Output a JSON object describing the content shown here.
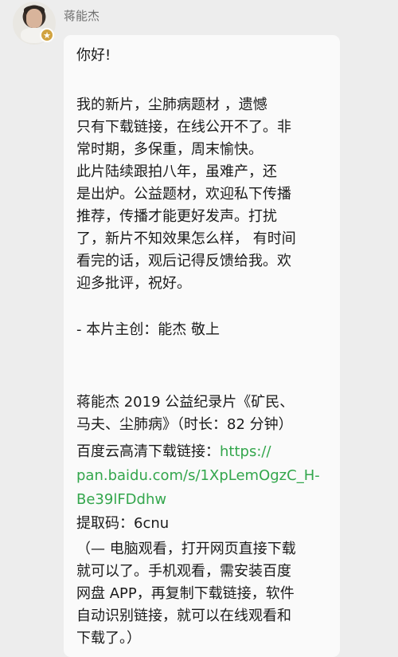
{
  "chat": {
    "sender_name": "蒋能杰",
    "avatar_icon": "person-avatar",
    "badge_icon": "star-badge-icon",
    "message_lines": [
      "你好!",
      "    我的新片，尘肺病题材 ，遗憾",
      "只有下载链接，在线公开不了。非",
      "常时期，多保重，周末愉快。",
      "  此片陆续跟拍八年，虽难产，还",
      "是出炉。公益题材，欢迎私下传播",
      "推荐，传播才能更好发声。打扰",
      "了，新片不知效果怎么样， 有时间",
      "看完的话，观后记得反馈给我。欢",
      "迎多批评，祝好。",
      "- 本片主创：能杰 敬上",
      "  蒋能杰 2019 公益纪录片《矿民、",
      "马夫、尘肺病》（时长：82 分钟）",
      "百度云高清下载链接：",
      "https://",
      "pan.baidu.com/s/1XpLemOgzC_H-",
      "Be39lFDdhw",
      "提取码：6cnu",
      "（— 电脑观看，打开网页直接下载",
      "就可以了。手机观看，需安装百度",
      "网盘 APP，再复制下载链接，软件",
      "自动识别链接，就可以在线观看和",
      "下载了。）"
    ]
  },
  "colors": {
    "background": "#ededed",
    "bubble": "#fafafa",
    "text": "#1b1b1b",
    "link": "#33a64c",
    "sender": "#707070"
  }
}
